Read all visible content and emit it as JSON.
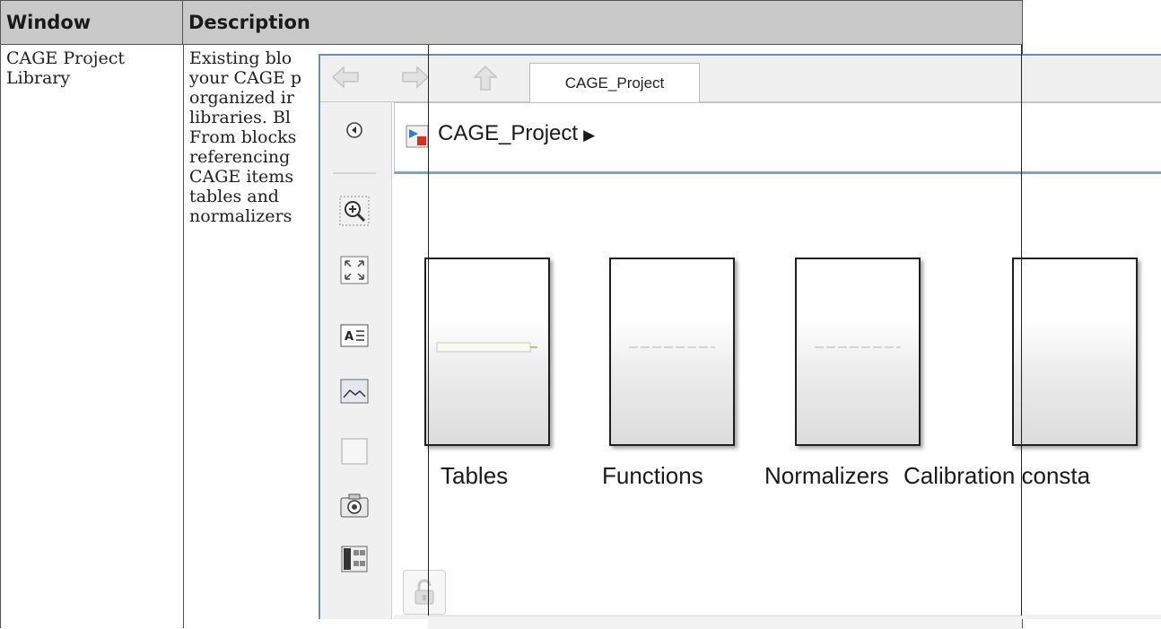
{
  "table": {
    "headers": {
      "window": "Window",
      "description": "Description"
    },
    "rows": [
      {
        "window": "CAGE Project Library",
        "description_lines": [
          "Existing blo",
          "your CAGE p",
          "organized ir",
          "libraries. Bl",
          "From blocks",
          "referencing",
          "CAGE items",
          "tables and",
          "normalizers"
        ]
      }
    ]
  },
  "screenshot": {
    "nav": {
      "back_icon": "back-arrow-icon",
      "forward_icon": "forward-arrow-icon",
      "up_icon": "up-arrow-icon"
    },
    "tab_label": "CAGE_Project",
    "address": {
      "text": "CAGE_Project",
      "arrow": "▶"
    },
    "toolbar_icons": [
      "hide-browser-icon",
      "zoom-icon",
      "fit-view-icon",
      "annotation-icon",
      "image-icon",
      "area-icon",
      "screenshot-icon",
      "library-browser-icon"
    ],
    "blocks": [
      {
        "label": "Tables"
      },
      {
        "label": "Functions"
      },
      {
        "label": "Normalizers"
      },
      {
        "label": "Calibration consta"
      }
    ],
    "lock_icon": "unlock-icon"
  }
}
